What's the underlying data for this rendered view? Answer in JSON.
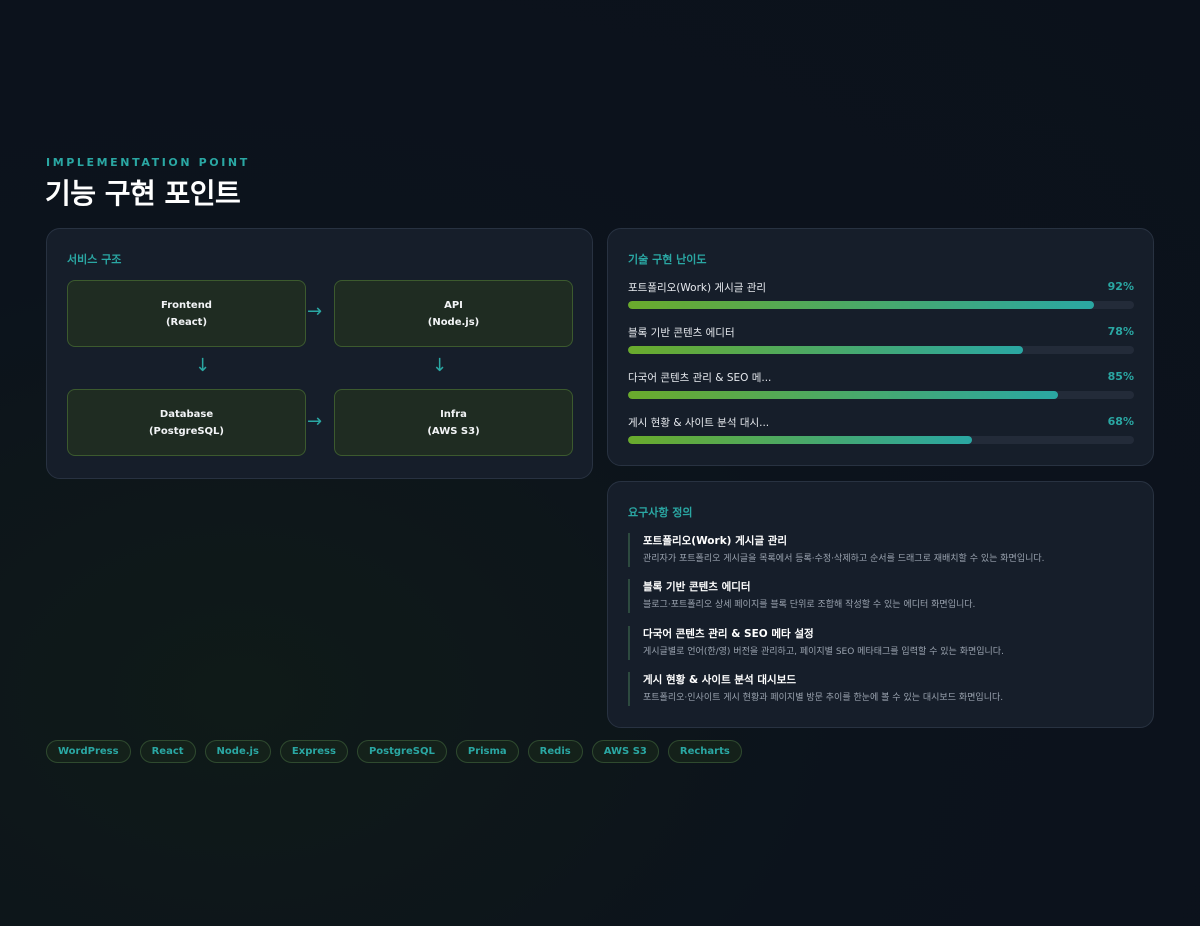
{
  "header": {
    "eyebrow": "IMPLEMENTATION POINT",
    "title": "기능 구현 포인트"
  },
  "service": {
    "title": "서비스 구조",
    "nodes": [
      {
        "name": "Frontend",
        "detail": "(React)"
      },
      {
        "name": "API",
        "detail": "(Node.js)"
      },
      {
        "name": "Database",
        "detail": "(PostgreSQL)"
      },
      {
        "name": "Infra",
        "detail": "(AWS S3)"
      }
    ],
    "arrow_right": "→",
    "arrow_down": "↓"
  },
  "difficulty": {
    "title": "기술 구현 난이도",
    "items": [
      {
        "label": "포트폴리오(Work) 게시글 관리",
        "percent_text": "92%",
        "value": 92
      },
      {
        "label": "블록 기반 콘텐츠 에디터",
        "percent_text": "78%",
        "value": 78
      },
      {
        "label": "다국어 콘텐츠 관리 & SEO 메...",
        "percent_text": "85%",
        "value": 85
      },
      {
        "label": "게시 현황 & 사이트 분석 대시...",
        "percent_text": "68%",
        "value": 68
      }
    ]
  },
  "requirements": {
    "title": "요구사항 정의",
    "items": [
      {
        "title": "포트폴리오(Work) 게시글 관리",
        "desc": "관리자가 포트폴리오 게시글을 목록에서 등록·수정·삭제하고 순서를 드래그로 재배치할 수 있는 화면입니다."
      },
      {
        "title": "블록 기반 콘텐츠 에디터",
        "desc": "블로그·포트폴리오 상세 페이지를 블록 단위로 조합해 작성할 수 있는 에디터 화면입니다."
      },
      {
        "title": "다국어 콘텐츠 관리 & SEO 메타 설정",
        "desc": "게시글별로 언어(한/영) 버전을 관리하고, 페이지별 SEO 메타태그를 입력할 수 있는 화면입니다."
      },
      {
        "title": "게시 현황 & 사이트 분석 대시보드",
        "desc": "포트폴리오·인사이트 게시 현황과 페이지별 방문 추이를 한눈에 볼 수 있는 대시보드 화면입니다."
      }
    ]
  },
  "tags": [
    "WordPress",
    "React",
    "Node.js",
    "Express",
    "PostgreSQL",
    "Prisma",
    "Redis",
    "AWS S3",
    "Recharts"
  ],
  "colors": {
    "accent": "#2aa7a3",
    "bar_start": "#6aab2c",
    "background": "#0b111b"
  }
}
